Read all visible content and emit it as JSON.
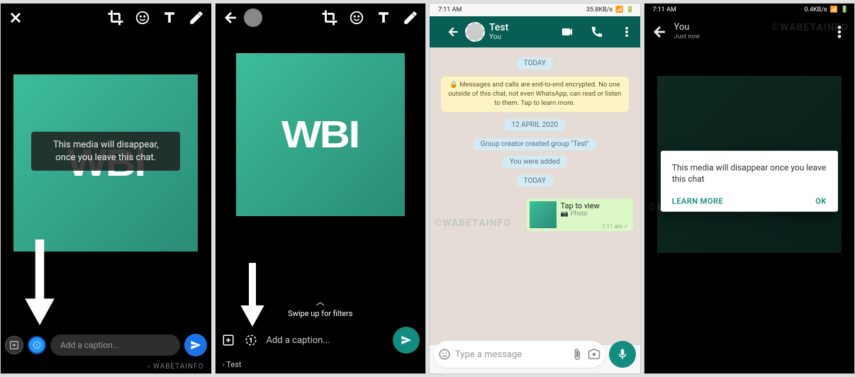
{
  "screen1": {
    "toast": "This media will disappear, once you leave this chat.",
    "caption_placeholder": "Add a caption...",
    "footer": "WABETAINFO"
  },
  "screen2": {
    "swipe_hint": "Swipe up for filters",
    "caption_placeholder": "Add a caption...",
    "recipient": "Test"
  },
  "screen3": {
    "status": {
      "time": "7:11 AM",
      "net": "35.8KB/s"
    },
    "header": {
      "title": "Test",
      "subtitle": "You"
    },
    "sys": {
      "today1": "TODAY",
      "encryption": "🔒 Messages and calls are end-to-end encrypted. No one outside of this chat, not even WhatsApp, can read or listen to them. Tap to learn more.",
      "date": "12 APRIL 2020",
      "created": "Group creator created group \"Test\"",
      "added": "You were added",
      "today2": "TODAY"
    },
    "msg": {
      "line1": "Tap to view",
      "line2": "Photo",
      "time": "7:11 am"
    },
    "input_placeholder": "Type a message",
    "watermark": "©WABETAINFO"
  },
  "screen4": {
    "status": {
      "time": "7:11 AM",
      "net": "0.4KB/s"
    },
    "header": {
      "title": "You",
      "subtitle": "Just now"
    },
    "dialog": {
      "text": "This media will disappear once you leave this chat",
      "learn": "LEARN MORE",
      "ok": "OK"
    },
    "watermark": "©WABETAINFO"
  },
  "wbi_logo_text": "WBI"
}
